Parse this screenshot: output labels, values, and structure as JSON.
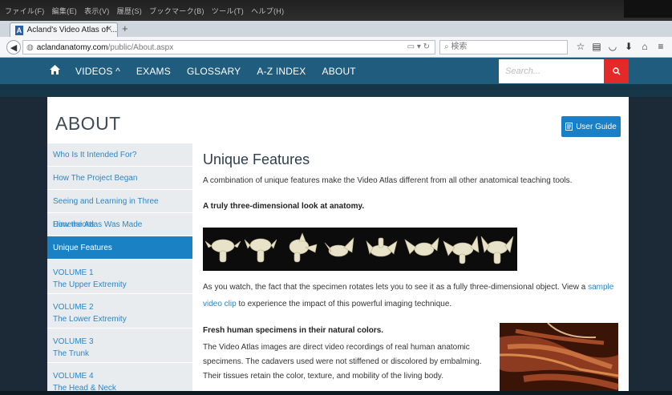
{
  "browser": {
    "menu": [
      "ファイル(F)",
      "編集(E)",
      "表示(V)",
      "履歴(S)",
      "ブックマーク(B)",
      "ツール(T)",
      "ヘルプ(H)"
    ],
    "tab_title": "Acland's Video Atlas of ...",
    "tab_favicon": "A",
    "url_host": "aclandanatomy.com",
    "url_path": "/public/About.aspx",
    "search_placeholder": "検索",
    "toolbar_icons": [
      "star-icon",
      "reading-list-icon",
      "pocket-icon",
      "download-icon",
      "home-icon",
      "menu-icon"
    ]
  },
  "site_nav": {
    "items": [
      "VIDEOS ^",
      "EXAMS",
      "GLOSSARY",
      "A-Z INDEX",
      "ABOUT"
    ],
    "search_placeholder": "Search..."
  },
  "page": {
    "title": "ABOUT",
    "user_guide_label": "User Guide"
  },
  "sidebar": {
    "items": [
      {
        "label": "Who Is It Intended For?"
      },
      {
        "label": "How The Project Began"
      },
      {
        "label": "Seeing and Learning in Three Dimensions"
      },
      {
        "label": "How the Atlas Was Made"
      },
      {
        "label": "Unique Features",
        "active": true
      },
      {
        "line1": "VOLUME 1",
        "line2": "The Upper Extremity"
      },
      {
        "line1": "VOLUME 2",
        "line2": "The Lower Extremity"
      },
      {
        "line1": "VOLUME 3",
        "line2": "The Trunk"
      },
      {
        "line1": "VOLUME 4",
        "line2": "The Head & Neck"
      }
    ]
  },
  "content": {
    "heading": "Unique Features",
    "intro": "A combination of unique features make the Video Atlas different from all other anatomical teaching tools.",
    "subheading_1": "A truly three-dimensional look at anatomy.",
    "para_2_before": "As you watch, the fact that the specimen rotates lets you to see it as a fully three-dimensional object. View a ",
    "para_2_link": "sample video clip",
    "para_2_after": " to experience the impact of this powerful imaging technique.",
    "subheading_2": "Fresh human specimens in their natural colors.",
    "para_3": "The Video Atlas images are direct video recordings of real human anatomic specimens. The cadavers used were not stiffened or discolored by embalming. Their tissues retain the color, texture, and mobility of the living body."
  },
  "colors": {
    "nav_bar": "#1f5c7e",
    "accent_blue": "#1a82c4",
    "search_red": "#e42929",
    "link": "#2a86c6"
  }
}
